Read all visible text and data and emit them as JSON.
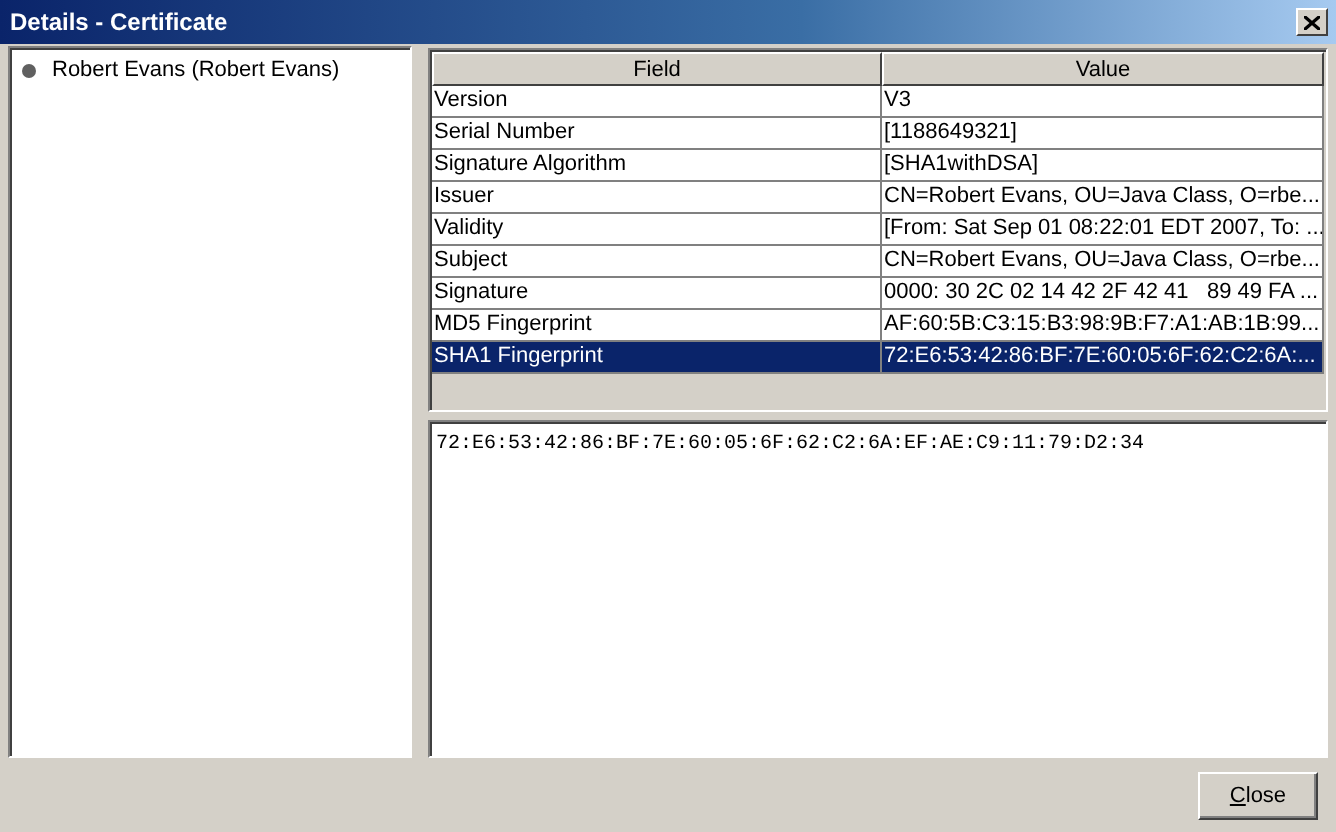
{
  "window": {
    "title": "Details - Certificate"
  },
  "tree": {
    "items": [
      {
        "label": "Robert Evans (Robert Evans)",
        "selected": false
      }
    ]
  },
  "table": {
    "columns": [
      "Field",
      "Value"
    ],
    "rows": [
      {
        "field": "Version",
        "value": "V3",
        "selected": false
      },
      {
        "field": "Serial Number",
        "value": "[1188649321]",
        "selected": false
      },
      {
        "field": "Signature Algorithm",
        "value": "[SHA1withDSA]",
        "selected": false
      },
      {
        "field": "Issuer",
        "value": "CN=Robert Evans, OU=Java Class, O=rbe...",
        "selected": false
      },
      {
        "field": "Validity",
        "value": "[From: Sat Sep 01 08:22:01 EDT 2007, To: ...",
        "selected": false
      },
      {
        "field": "Subject",
        "value": "CN=Robert Evans, OU=Java Class, O=rbe...",
        "selected": false
      },
      {
        "field": "Signature",
        "value": "0000: 30 2C 02 14 42 2F 42 41   89 49 FA ...",
        "selected": false
      },
      {
        "field": "MD5 Fingerprint",
        "value": "AF:60:5B:C3:15:B3:98:9B:F7:A1:AB:1B:99...",
        "selected": false
      },
      {
        "field": "SHA1 Fingerprint",
        "value": "72:E6:53:42:86:BF:7E:60:05:6F:62:C2:6A:...",
        "selected": true
      }
    ]
  },
  "detail": {
    "value": "72:E6:53:42:86:BF:7E:60:05:6F:62:C2:6A:EF:AE:C9:11:79:D2:34"
  },
  "buttons": [
    "Close"
  ]
}
